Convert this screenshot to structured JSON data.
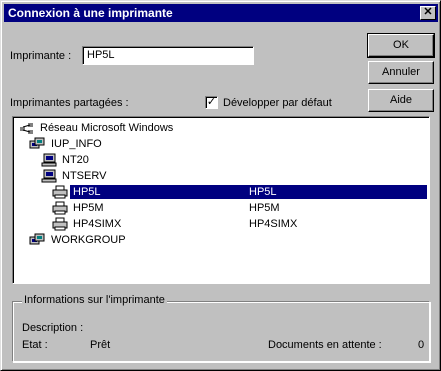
{
  "window": {
    "title": "Connexion à une imprimante"
  },
  "form": {
    "printer_label": "Imprimante :",
    "printer_value": "HP5L",
    "shared_label": "Imprimantes partagées :",
    "expand_label": "Développer par défaut",
    "expand_checked": true
  },
  "buttons": {
    "ok": "OK",
    "cancel": "Annuler",
    "help": "Aide"
  },
  "tree": [
    {
      "label": "Réseau Microsoft Windows",
      "icon": "network-icon",
      "level": 0,
      "selected": false,
      "detail": ""
    },
    {
      "label": "IUP_INFO",
      "icon": "domain-icon",
      "level": 1,
      "selected": false,
      "detail": ""
    },
    {
      "label": "NT20",
      "icon": "computer-icon",
      "level": 2,
      "selected": false,
      "detail": ""
    },
    {
      "label": "NTSERV",
      "icon": "computer-icon",
      "level": 2,
      "selected": false,
      "detail": ""
    },
    {
      "label": "HP5L",
      "icon": "printer-icon",
      "level": 3,
      "selected": true,
      "detail": "HP5L"
    },
    {
      "label": "HP5M",
      "icon": "printer-icon",
      "level": 3,
      "selected": false,
      "detail": "HP5M"
    },
    {
      "label": "HP4SIMX",
      "icon": "printer-icon",
      "level": 3,
      "selected": false,
      "detail": "HP4SIMX"
    },
    {
      "label": "WORKGROUP",
      "icon": "domain-icon",
      "level": 1,
      "selected": false,
      "detail": ""
    }
  ],
  "info": {
    "group_label": "Informations sur l'imprimante",
    "description_label": "Description :",
    "status_label": "Etat :",
    "status_value": "Prêt",
    "queue_label": "Documents en attente :",
    "queue_value": "0"
  },
  "colors": {
    "face": "#c0c0c0",
    "titlebar": "#000080",
    "selection": "#000080"
  }
}
